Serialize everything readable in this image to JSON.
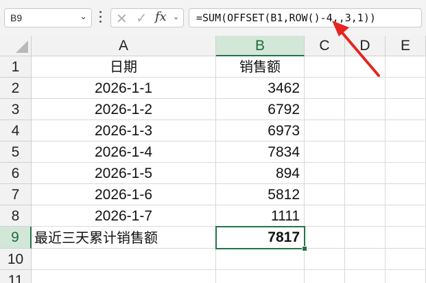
{
  "formula_bar": {
    "name_box": "B9",
    "name_box_dropdown_icon": "chevron-down-icon",
    "more_icon": "vertical-dots-icon",
    "cancel_icon": "✕",
    "enter_icon": "✓",
    "function_icon": "fx",
    "function_dropdown_icon": "chevron-down-icon",
    "formula": "=SUM(OFFSET(B1,ROW()-4,,3,1))"
  },
  "columns": [
    "A",
    "B",
    "C",
    "D",
    "E"
  ],
  "selected_column": "B",
  "rows": [
    "1",
    "2",
    "3",
    "4",
    "5",
    "6",
    "7",
    "8",
    "9",
    "10",
    "11"
  ],
  "selected_row": "9",
  "cells": {
    "A1": "日期",
    "B1": "销售额",
    "A2": "2026-1-1",
    "B2": "3462",
    "A3": "2026-1-2",
    "B3": "6792",
    "A4": "2026-1-3",
    "B4": "6973",
    "A5": "2026-1-4",
    "B5": "7834",
    "A6": "2026-1-5",
    "B6": "894",
    "A7": "2026-1-6",
    "B7": "5812",
    "A8": "2026-1-7",
    "B8": "1111",
    "A9": "最近三天累计销售额",
    "B9": "7817"
  },
  "colors": {
    "accent": "#217346",
    "annotation_arrow": "#e8231f",
    "header_bg": "#f2f2f2",
    "selected_header_bg": "#d3e7d9"
  },
  "annotation_icon": "red-arrow-icon"
}
